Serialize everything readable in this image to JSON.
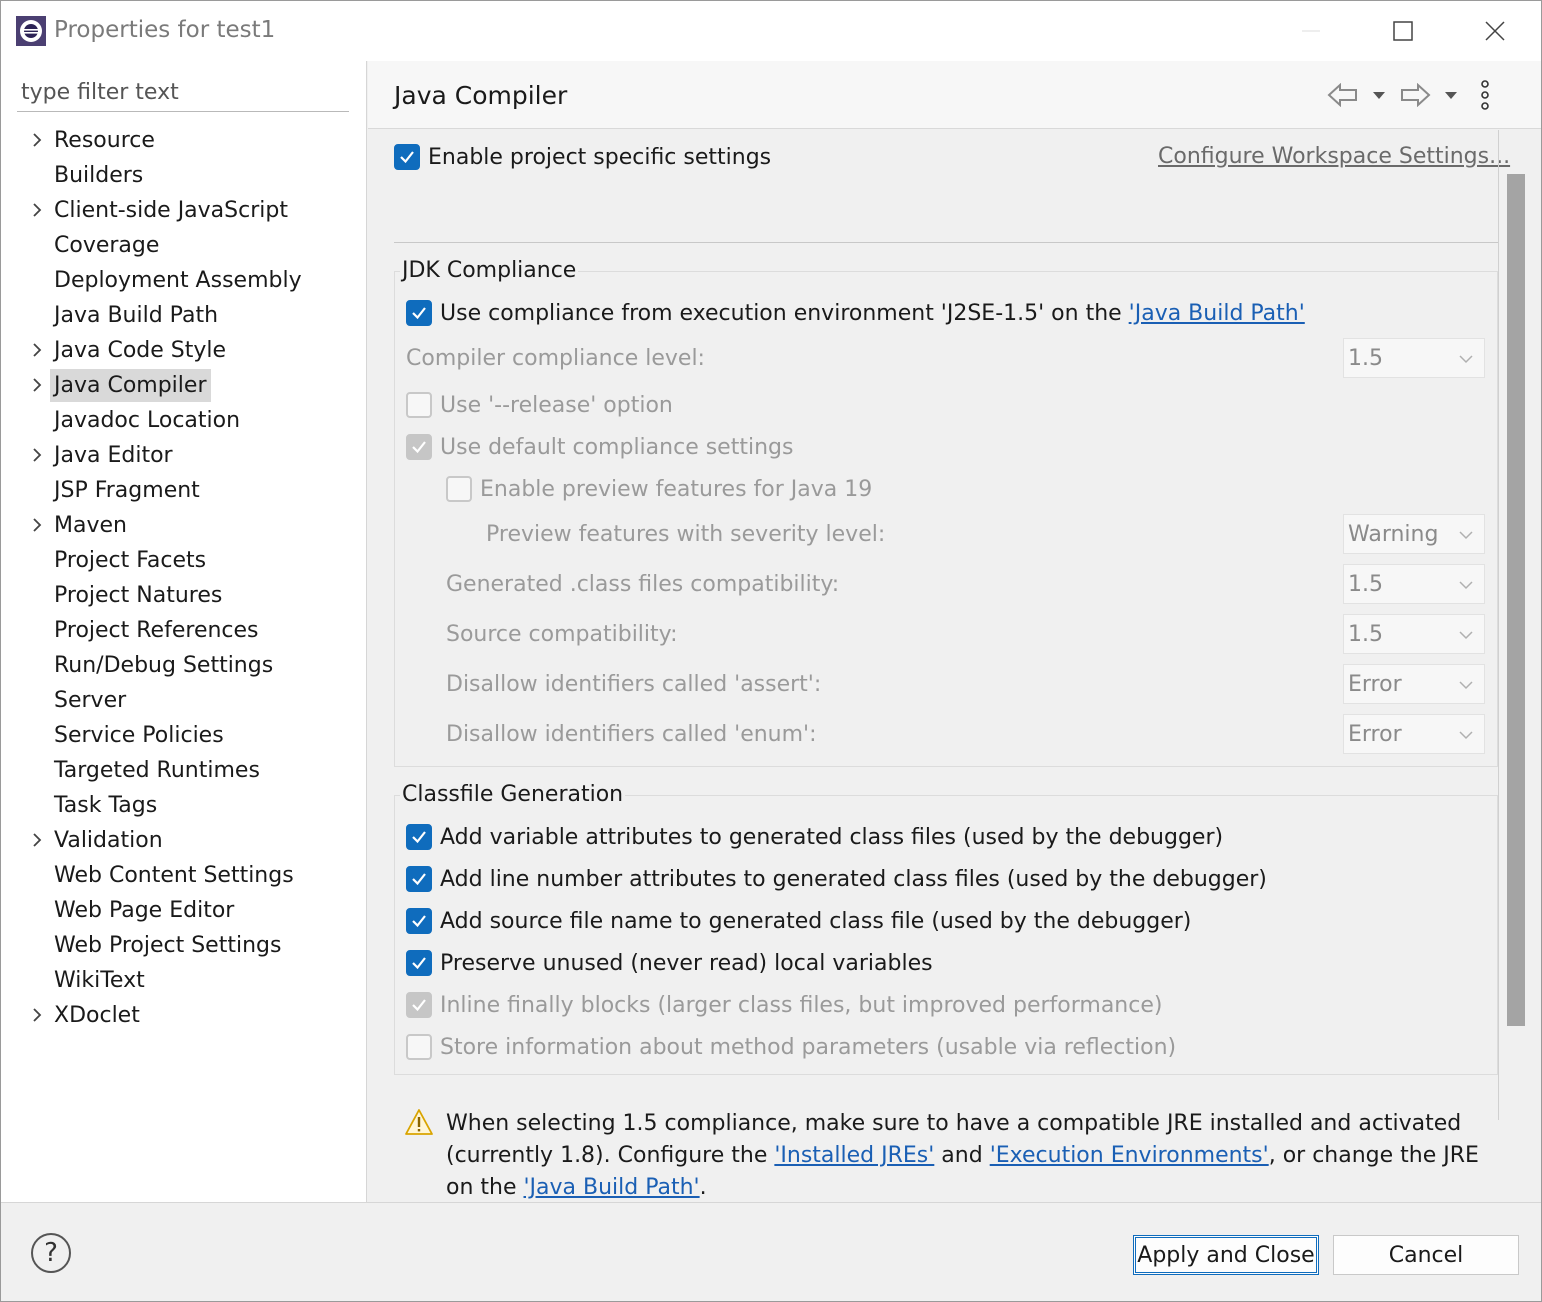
{
  "window": {
    "title": "Properties for test1"
  },
  "filter": {
    "placeholder": "type filter text"
  },
  "tree": [
    {
      "label": "Resource",
      "expandable": true
    },
    {
      "label": "Builders",
      "expandable": false
    },
    {
      "label": "Client-side JavaScript",
      "expandable": true
    },
    {
      "label": "Coverage",
      "expandable": false
    },
    {
      "label": "Deployment Assembly",
      "expandable": false
    },
    {
      "label": "Java Build Path",
      "expandable": false
    },
    {
      "label": "Java Code Style",
      "expandable": true
    },
    {
      "label": "Java Compiler",
      "expandable": true,
      "selected": true
    },
    {
      "label": "Javadoc Location",
      "expandable": false
    },
    {
      "label": "Java Editor",
      "expandable": true
    },
    {
      "label": "JSP Fragment",
      "expandable": false
    },
    {
      "label": "Maven",
      "expandable": true
    },
    {
      "label": "Project Facets",
      "expandable": false
    },
    {
      "label": "Project Natures",
      "expandable": false
    },
    {
      "label": "Project References",
      "expandable": false
    },
    {
      "label": "Run/Debug Settings",
      "expandable": false
    },
    {
      "label": "Server",
      "expandable": false
    },
    {
      "label": "Service Policies",
      "expandable": false
    },
    {
      "label": "Targeted Runtimes",
      "expandable": false
    },
    {
      "label": "Task Tags",
      "expandable": false
    },
    {
      "label": "Validation",
      "expandable": true
    },
    {
      "label": "Web Content Settings",
      "expandable": false
    },
    {
      "label": "Web Page Editor",
      "expandable": false
    },
    {
      "label": "Web Project Settings",
      "expandable": false
    },
    {
      "label": "WikiText",
      "expandable": false
    },
    {
      "label": "XDoclet",
      "expandable": true
    }
  ],
  "page": {
    "title": "Java Compiler",
    "enable_project_specific": {
      "label": "Enable project specific settings",
      "checked": true
    },
    "configure_workspace_link": "Configure Workspace Settings...",
    "jdk": {
      "title": "JDK Compliance",
      "use_compliance": {
        "prefix": "Use compliance from execution environment 'J2SE-1.5' on the ",
        "link": "'Java Build Path'",
        "checked": true
      },
      "compiler_level": {
        "label": "Compiler compliance level:",
        "value": "1.5"
      },
      "release_option": {
        "label": "Use '--release' option",
        "checked": false
      },
      "default_compliance": {
        "label": "Use default compliance settings",
        "checked": true
      },
      "preview": {
        "label": "Enable preview features for Java 19",
        "checked": false
      },
      "preview_severity": {
        "label": "Preview features with severity level:",
        "value": "Warning"
      },
      "class_compat": {
        "label": "Generated .class files compatibility:",
        "value": "1.5"
      },
      "source_compat": {
        "label": "Source compatibility:",
        "value": "1.5"
      },
      "assert_ident": {
        "label": "Disallow identifiers called 'assert':",
        "value": "Error"
      },
      "enum_ident": {
        "label": "Disallow identifiers called 'enum':",
        "value": "Error"
      }
    },
    "classfile": {
      "title": "Classfile Generation",
      "var_attrs": {
        "label": "Add variable attributes to generated class files (used by the debugger)",
        "checked": true
      },
      "line_attrs": {
        "label": "Add line number attributes to generated class files (used by the debugger)",
        "checked": true
      },
      "source_name": {
        "label": "Add source file name to generated class file (used by the debugger)",
        "checked": true
      },
      "preserve_unused": {
        "label": "Preserve unused (never read) local variables",
        "checked": true
      },
      "inline_finally": {
        "label": "Inline finally blocks (larger class files, but improved performance)",
        "checked": true
      },
      "method_params": {
        "label": "Store information about method parameters (usable via reflection)",
        "checked": false
      }
    },
    "warning": {
      "t1": "When selecting 1.5 compliance, make sure to have a compatible JRE installed and activated (currently 1.8). Configure the ",
      "link1": "'Installed JREs'",
      "t2": " and ",
      "link2": "'Execution Environments'",
      "t3": ", or change the JRE on the ",
      "link3": "'Java Build Path'",
      "t4": "."
    }
  },
  "buttons": {
    "apply_close": "Apply and Close",
    "cancel": "Cancel",
    "help": "?"
  },
  "colors": {
    "accent": "#0f6cbd",
    "link": "#1a5fb4",
    "selection": "#d9d9d9"
  }
}
